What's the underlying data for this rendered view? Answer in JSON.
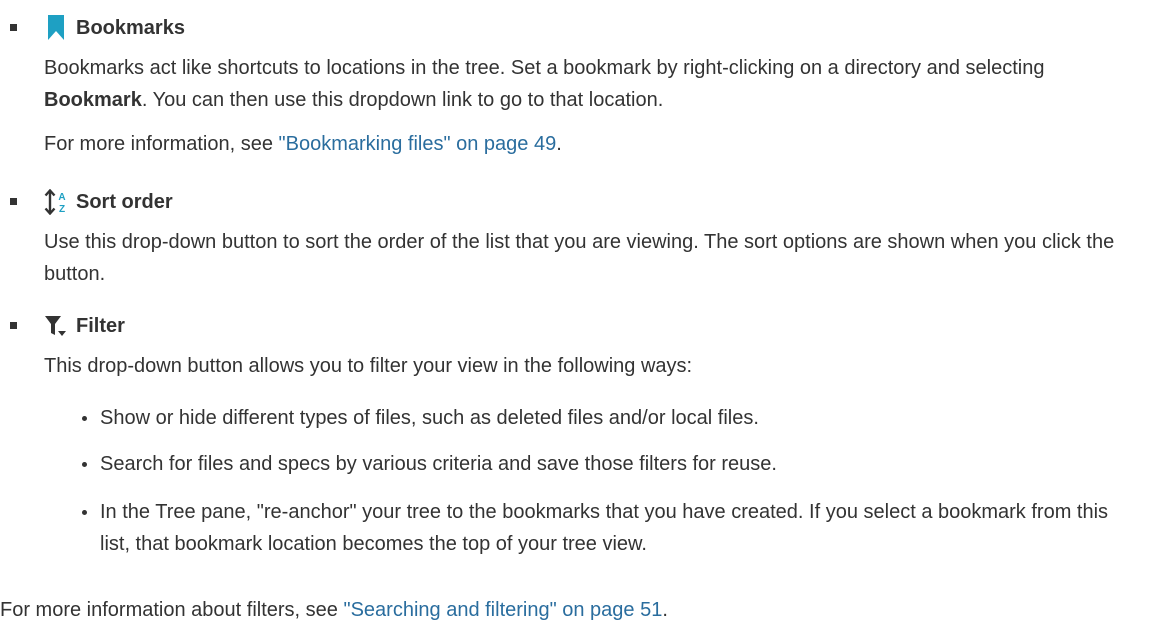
{
  "bookmarks": {
    "title": "Bookmarks",
    "desc_part1": "Bookmarks act like shortcuts to locations in the tree. Set a bookmark by right-clicking on a directory and selecting ",
    "desc_bold": "Bookmark",
    "desc_part2": ". You can then use this dropdown link to go to that location.",
    "more_prefix": "For more information, see ",
    "more_link": "\"Bookmarking files\" on page 49",
    "more_suffix": ".",
    "icon": "bookmark-icon",
    "icon_color": "#1ea0c3"
  },
  "sort": {
    "title": "Sort order",
    "desc": "Use this drop-down button to sort the order of the list that you are viewing. The sort options are shown when you click the button.",
    "icon": "sort-order-icon",
    "icon_letter_top": "A",
    "icon_letter_bottom": "Z",
    "icon_color": "#1ea0c3"
  },
  "filter": {
    "title": "Filter",
    "intro": "This drop-down button allows you to filter your view in the following ways:",
    "icon": "filter-icon",
    "bullets": [
      "Show or hide different types of files, such as deleted files and/or local files.",
      "Search for files and specs by various criteria and save those filters for reuse.",
      "In the Tree pane, \"re-anchor\" your tree to the bookmarks that you have created. If you select a bookmark from this list, that bookmark location becomes the top of your tree view."
    ],
    "more_prefix": "For more information about filters, see ",
    "more_link": "\"Searching and filtering\" on page 51",
    "more_suffix": "."
  },
  "colors": {
    "text": "#333333",
    "link": "#2a6d9e",
    "accent": "#1ea0c3"
  }
}
